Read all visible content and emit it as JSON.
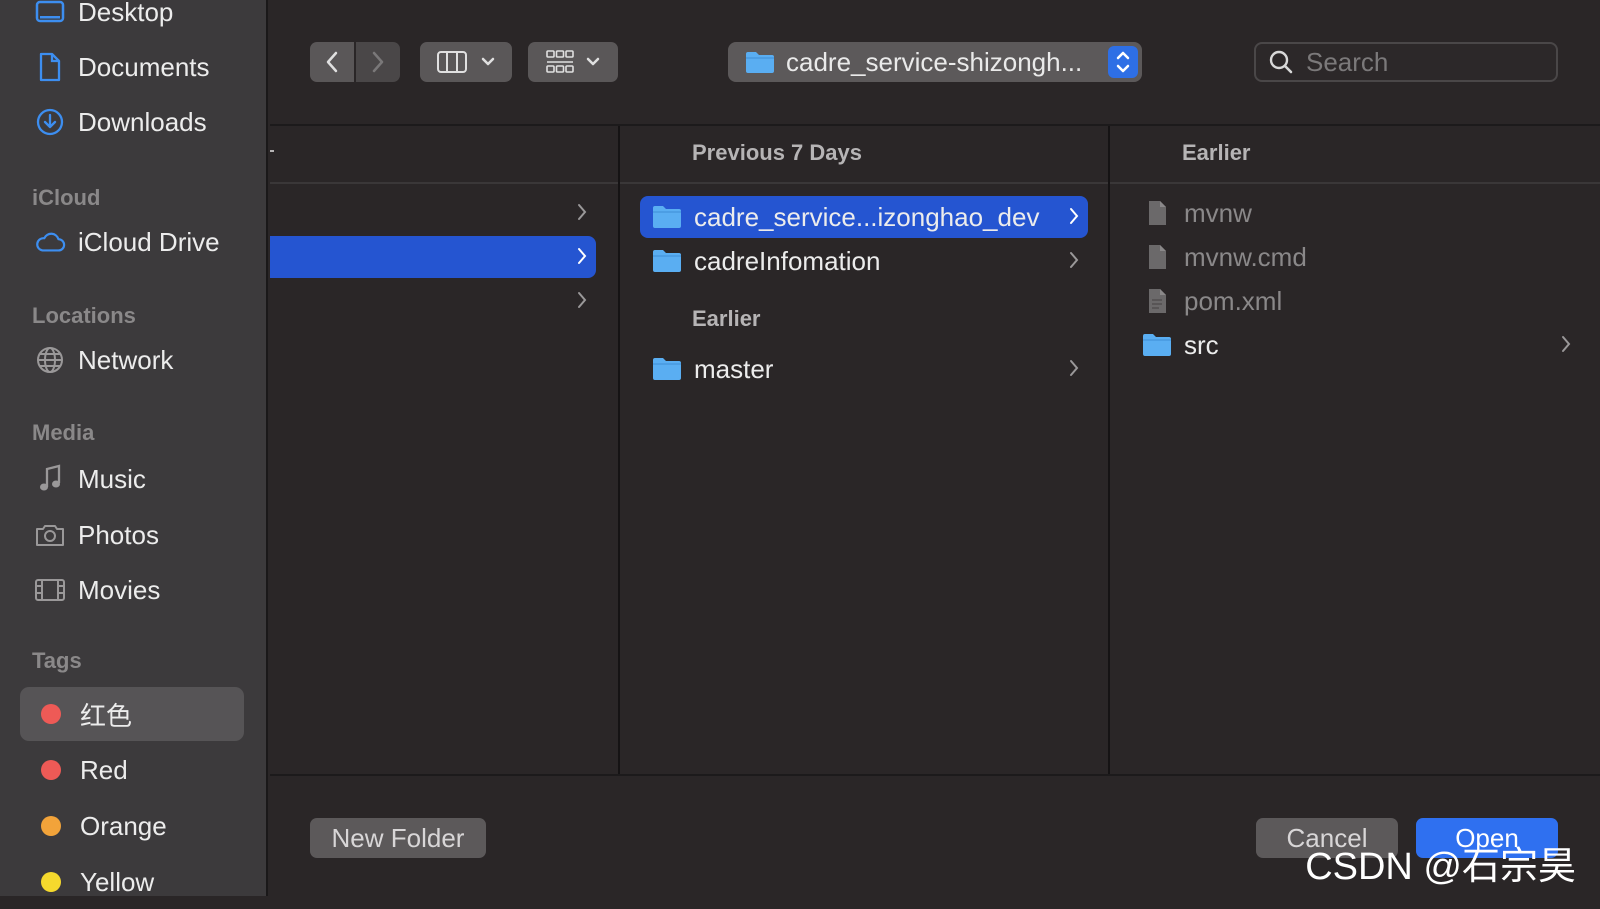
{
  "sidebar": {
    "favorites": [
      {
        "label": "Desktop",
        "icon": "desktop-icon"
      },
      {
        "label": "Documents",
        "icon": "document-icon"
      },
      {
        "label": "Downloads",
        "icon": "download-icon"
      }
    ],
    "icloud_header": "iCloud",
    "icloud_items": [
      {
        "label": "iCloud Drive",
        "icon": "cloud-icon"
      }
    ],
    "locations_header": "Locations",
    "locations_items": [
      {
        "label": "Network",
        "icon": "globe-icon"
      }
    ],
    "media_header": "Media",
    "media_items": [
      {
        "label": "Music",
        "icon": "music-note-icon"
      },
      {
        "label": "Photos",
        "icon": "camera-icon"
      },
      {
        "label": "Movies",
        "icon": "film-icon"
      }
    ],
    "tags_header": "Tags",
    "tags": [
      {
        "label": "红色",
        "color": "#ee5a56",
        "selected": true
      },
      {
        "label": "Red",
        "color": "#ee5a56"
      },
      {
        "label": "Orange",
        "color": "#f2a33a"
      },
      {
        "label": "Yellow",
        "color": "#f5d92d"
      }
    ]
  },
  "toolbar": {
    "path_label": "cadre_service-shizongh...",
    "search_placeholder": "Search"
  },
  "browser": {
    "col2": {
      "header": "Previous 7 Days",
      "items": [
        {
          "label": "cadre_service...izonghao_dev",
          "selected": true
        },
        {
          "label": "cadreInfomation"
        }
      ],
      "earlier_header": "Earlier",
      "earlier_items": [
        {
          "label": "master"
        }
      ]
    },
    "col3": {
      "header": "Earlier",
      "items": [
        {
          "label": "mvnw",
          "kind": "file"
        },
        {
          "label": "mvnw.cmd",
          "kind": "file"
        },
        {
          "label": "pom.xml",
          "kind": "file"
        },
        {
          "label": "src",
          "kind": "folder"
        }
      ]
    }
  },
  "bottom": {
    "new_folder": "New Folder",
    "cancel": "Cancel",
    "open": "Open"
  },
  "watermark": "CSDN @石宗昊",
  "colors": {
    "accent": "#2f70f0",
    "selection": "#2555d1",
    "folder": "#5aaef2"
  }
}
